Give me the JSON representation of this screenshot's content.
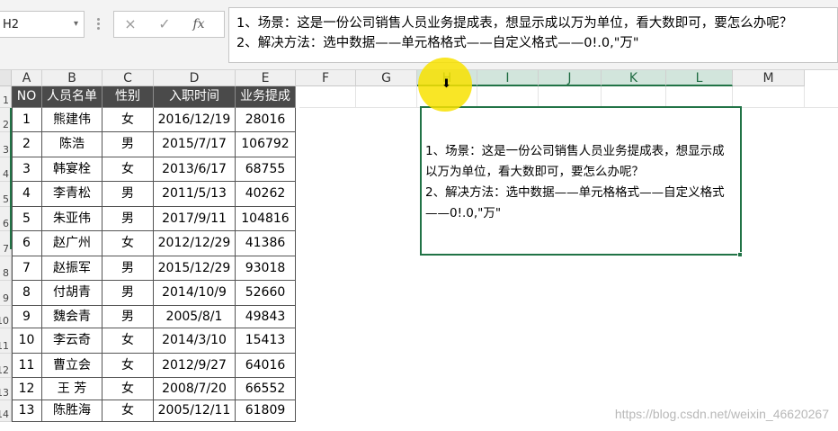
{
  "formula_bar": {
    "name_box": "H2",
    "cancel_icon": "×",
    "enter_icon": "✓",
    "fx_label": "fx",
    "content": "1、场景：这是一份公司销售人员业务提成表，想显示成以万为单位，看大数即可，要怎么办呢？\n2、解决方法：选中数据——单元格格式——自定义格式——0!.0,\"万\""
  },
  "columns": [
    "A",
    "B",
    "C",
    "D",
    "E",
    "F",
    "G",
    "H",
    "I",
    "J",
    "K",
    "L",
    "M"
  ],
  "selected_columns": [
    "H",
    "I",
    "J",
    "K",
    "L"
  ],
  "rows": [
    "1",
    "2",
    "3",
    "4",
    "5",
    "6",
    "7",
    "8",
    "9",
    "10",
    "11",
    "12",
    "13",
    "14"
  ],
  "table": {
    "headers": [
      "NO",
      "人员名单",
      "性别",
      "入职时间",
      "业务提成"
    ],
    "rows": [
      [
        "1",
        "熊建伟",
        "女",
        "2016/12/19",
        "28016"
      ],
      [
        "2",
        "陈浩",
        "男",
        "2015/7/17",
        "106792"
      ],
      [
        "3",
        "韩宴栓",
        "女",
        "2013/6/17",
        "68755"
      ],
      [
        "4",
        "李青松",
        "男",
        "2011/5/13",
        "40262"
      ],
      [
        "5",
        "朱亚伟",
        "男",
        "2017/9/11",
        "104816"
      ],
      [
        "6",
        "赵广州",
        "女",
        "2012/12/29",
        "41386"
      ],
      [
        "7",
        "赵振军",
        "男",
        "2015/12/29",
        "93018"
      ],
      [
        "8",
        "付胡青",
        "男",
        "2014/10/9",
        "52660"
      ],
      [
        "9",
        "魏会青",
        "男",
        "2005/8/1",
        "49843"
      ],
      [
        "10",
        "李云奇",
        "女",
        "2014/3/10",
        "15413"
      ],
      [
        "11",
        "曹立会",
        "女",
        "2012/9/27",
        "64016"
      ],
      [
        "12",
        "王  芳",
        "女",
        "2008/7/20",
        "66552"
      ],
      [
        "13",
        "陈胜海",
        "女",
        "2005/12/11",
        "61809"
      ]
    ]
  },
  "text_box": {
    "content": "1、场景：这是一份公司销售人员业务提成表，想显示成\n以万为单位，看大数即可，要怎么办呢？\n2、解决方法：选中数据——单元格格式——自定义格式\n——0!.0,\"万\""
  },
  "watermark": "https://blog.csdn.net/weixin_46620267",
  "colors": {
    "selection_green": "#217346",
    "header_fill": "#4a4a4a",
    "cursor_highlight": "#f8e200"
  }
}
